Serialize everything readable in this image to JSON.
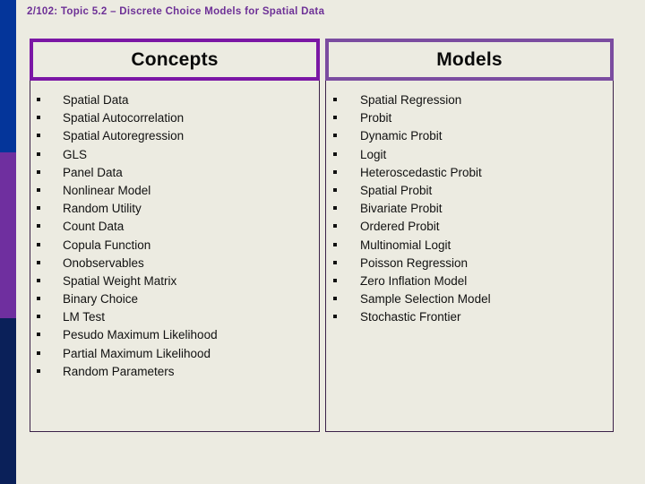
{
  "slide": {
    "title": "2/102: Topic 5.2 – Discrete Choice Models for Spatial Data",
    "background_color": "#ecebe1",
    "title_color": "#6d3096"
  },
  "sidebar": {
    "bands": [
      {
        "name": "band-blue",
        "color": "#04359a"
      },
      {
        "name": "band-purple",
        "color": "#6f2f9f"
      },
      {
        "name": "band-navy",
        "color": "#0a2059"
      }
    ]
  },
  "panels": [
    {
      "id": "concepts",
      "header": "Concepts",
      "border_color": "#7b17a5",
      "items": [
        "Spatial Data",
        "Spatial Autocorrelation",
        "Spatial Autoregression",
        "GLS",
        "Panel Data",
        "Nonlinear Model",
        "Random Utility",
        "Count Data",
        "Copula Function",
        "Onobservables",
        "Spatial Weight Matrix",
        "Binary Choice",
        "LM Test",
        "Pesudo Maximum Likelihood",
        "Partial Maximum Likelihood",
        "Random Parameters"
      ]
    },
    {
      "id": "models",
      "header": "Models",
      "border_color": "#7b4ca0",
      "items": [
        "Spatial Regression",
        "Probit",
        "Dynamic Probit",
        "Logit",
        "Heteroscedastic Probit",
        "Spatial Probit",
        "Bivariate Probit",
        "Ordered Probit",
        "Multinomial Logit",
        "Poisson Regression",
        "Zero Inflation Model",
        "Sample Selection Model",
        "Stochastic Frontier"
      ]
    }
  ]
}
